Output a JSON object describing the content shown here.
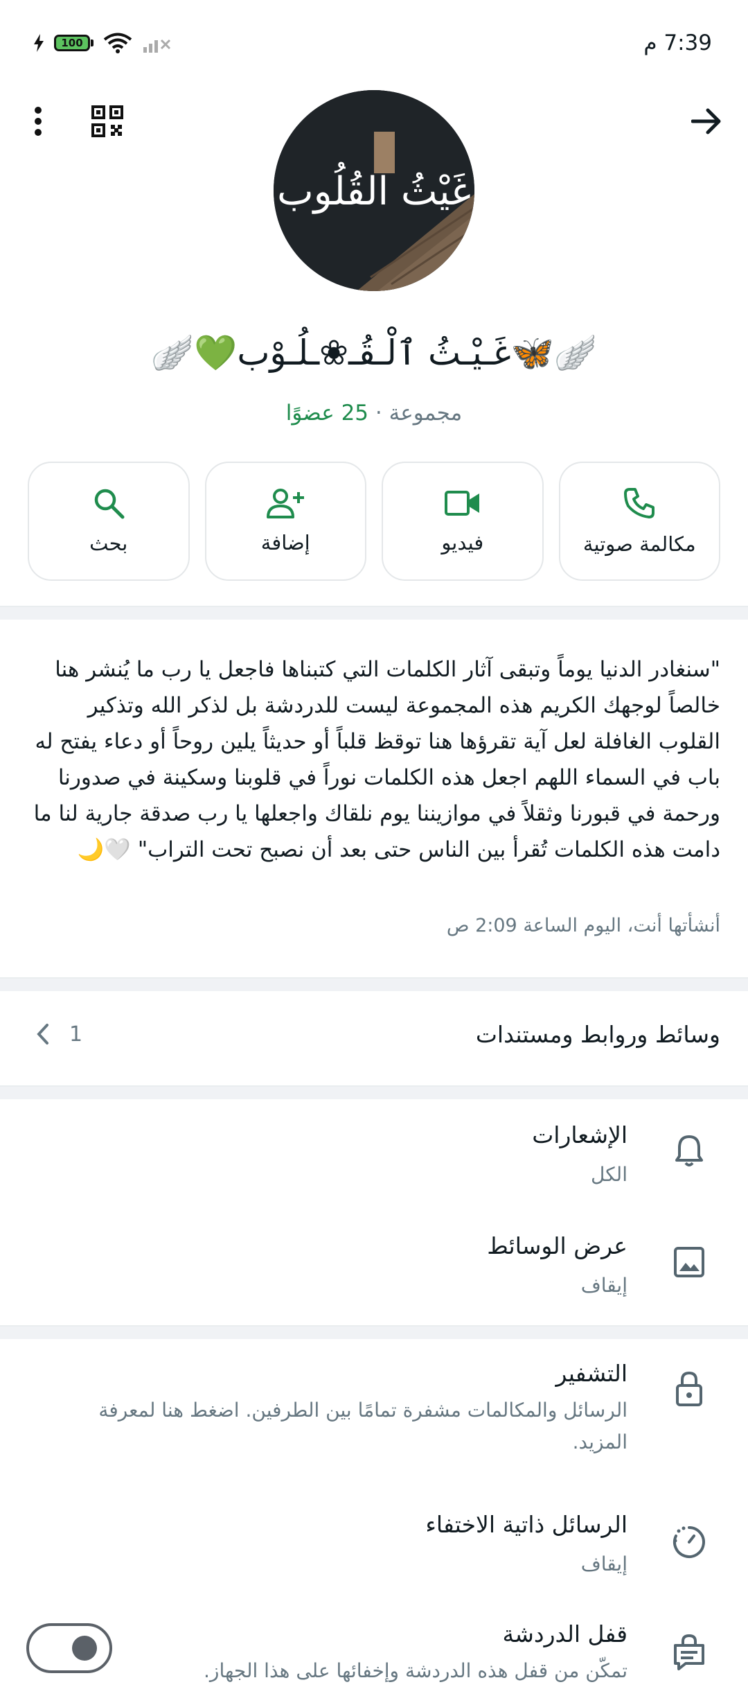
{
  "status_bar": {
    "time": "7:39 م",
    "battery": "100"
  },
  "header": {
    "back_label": "",
    "qr_label": "",
    "menu_label": ""
  },
  "group": {
    "avatar_text": "غَيْثُ القُلُوب",
    "name": "🪽🦋غَـيْـثُ ٱلْـقُـ❀ـلُـوْب💚🪽",
    "type": "مجموعة ·",
    "members": "25 عضوًا"
  },
  "actions": [
    {
      "label": "مكالمة صوتية",
      "icon": "phone-icon"
    },
    {
      "label": "فيديو",
      "icon": "video-icon"
    },
    {
      "label": "إضافة",
      "icon": "add-person-icon"
    },
    {
      "label": "بحث",
      "icon": "search-icon"
    }
  ],
  "description": {
    "text": "\"سنغادر الدنيا يوماً وتبقى آثار الكلمات التي كتبناها فاجعل يا رب ما يُنشر هنا خالصاً لوجهك الكريم هذه المجموعة ليست للدردشة بل لذكر الله وتذكير القلوب الغافلة لعل آية تقرؤها هنا توقظ قلباً أو حديثاً يلين روحاً أو دعاء يفتح له باب في السماء اللهم اجعل هذه الكلمات نوراً في قلوبنا وسكينة في صدورنا ورحمة في قبورنا وثقلاً في موازيننا يوم نلقاك واجعلها يا رب صدقة جارية لنا ما دامت هذه الكلمات تُقرأ بين الناس حتى بعد أن نصبح تحت التراب\" 🤍🌙",
    "created": "أنشأتها أنت، اليوم الساعة 2:09 ص"
  },
  "media": {
    "title": "وسائط وروابط ومستندات",
    "count": "1"
  },
  "settings": {
    "notifications": {
      "title": "الإشعارات",
      "value": "الكل",
      "icon": "bell-icon"
    },
    "media_visibility": {
      "title": "عرض الوسائط",
      "value": "إيقاف",
      "icon": "image-icon"
    },
    "encryption": {
      "title": "التشفير",
      "value": "الرسائل والمكالمات مشفرة تمامًا بين الطرفين. اضغط هنا لمعرفة المزيد.",
      "icon": "lock-icon"
    },
    "disappearing": {
      "title": "الرسائل ذاتية الاختفاء",
      "value": "إيقاف",
      "icon": "timer-icon"
    },
    "chat_lock": {
      "title": "قفل الدردشة",
      "value": "تمكّن من قفل هذه الدردشة وإخفائها على هذا الجهاز.",
      "icon": "chat-lock-icon",
      "enabled": false
    }
  },
  "colors": {
    "accent": "#1f8c4d",
    "muted": "#667781",
    "divider": "#f0f2f5"
  }
}
